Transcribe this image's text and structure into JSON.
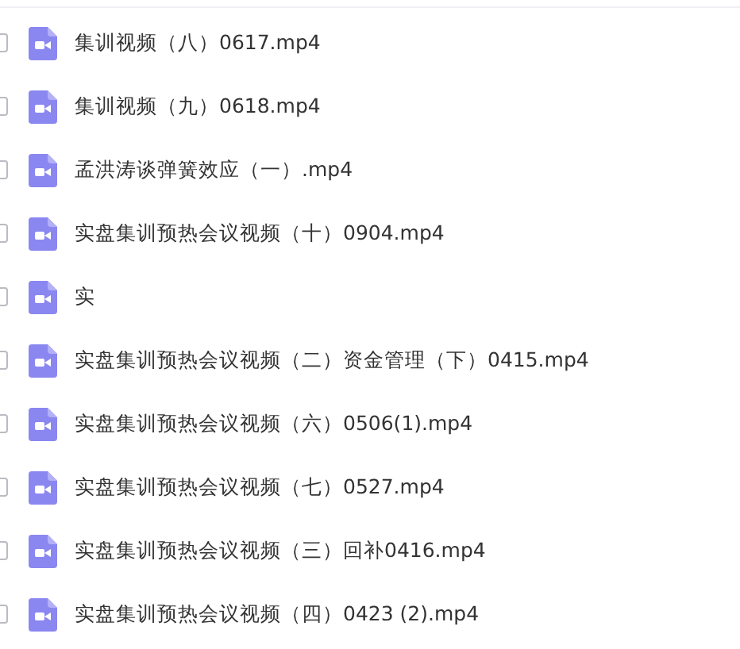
{
  "files": [
    {
      "name": "集训视频（八）0617.mp4",
      "checked": false
    },
    {
      "name": "集训视频（九）0618.mp4",
      "checked": false
    },
    {
      "name": "孟洪涛谈弹簧效应（一）.mp4",
      "checked": false
    },
    {
      "name": "实盘集训预热会议视频（十）0904.mp4",
      "checked": false
    },
    {
      "name": "实",
      "checked": false
    },
    {
      "name": "实盘集训预热会议视频（二）资金管理（下）0415.mp4",
      "checked": false
    },
    {
      "name": "实盘集训预热会议视频（六）0506(1).mp4",
      "checked": false
    },
    {
      "name": "实盘集训预热会议视频（七）0527.mp4",
      "checked": false
    },
    {
      "name": "实盘集训预热会议视频（三）回补0416.mp4",
      "checked": false
    },
    {
      "name": "实盘集训预热会议视频（四）0423 (2).mp4",
      "checked": false
    }
  ]
}
